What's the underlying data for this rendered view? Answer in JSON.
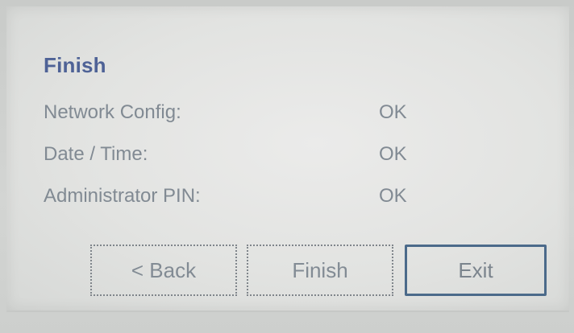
{
  "dialog": {
    "title": "Finish",
    "rows": [
      {
        "label": "Network Config:",
        "value": "OK"
      },
      {
        "label": "Date / Time:",
        "value": "OK"
      },
      {
        "label": "Administrator PIN:",
        "value": "OK"
      }
    ]
  },
  "buttons": {
    "back": "< Back",
    "finish": "Finish",
    "exit": "Exit"
  },
  "colors": {
    "title": "#4e6296",
    "text": "#818a93",
    "focus_border": "#4b6a8a",
    "screen_bg": "#e2e3e1"
  }
}
